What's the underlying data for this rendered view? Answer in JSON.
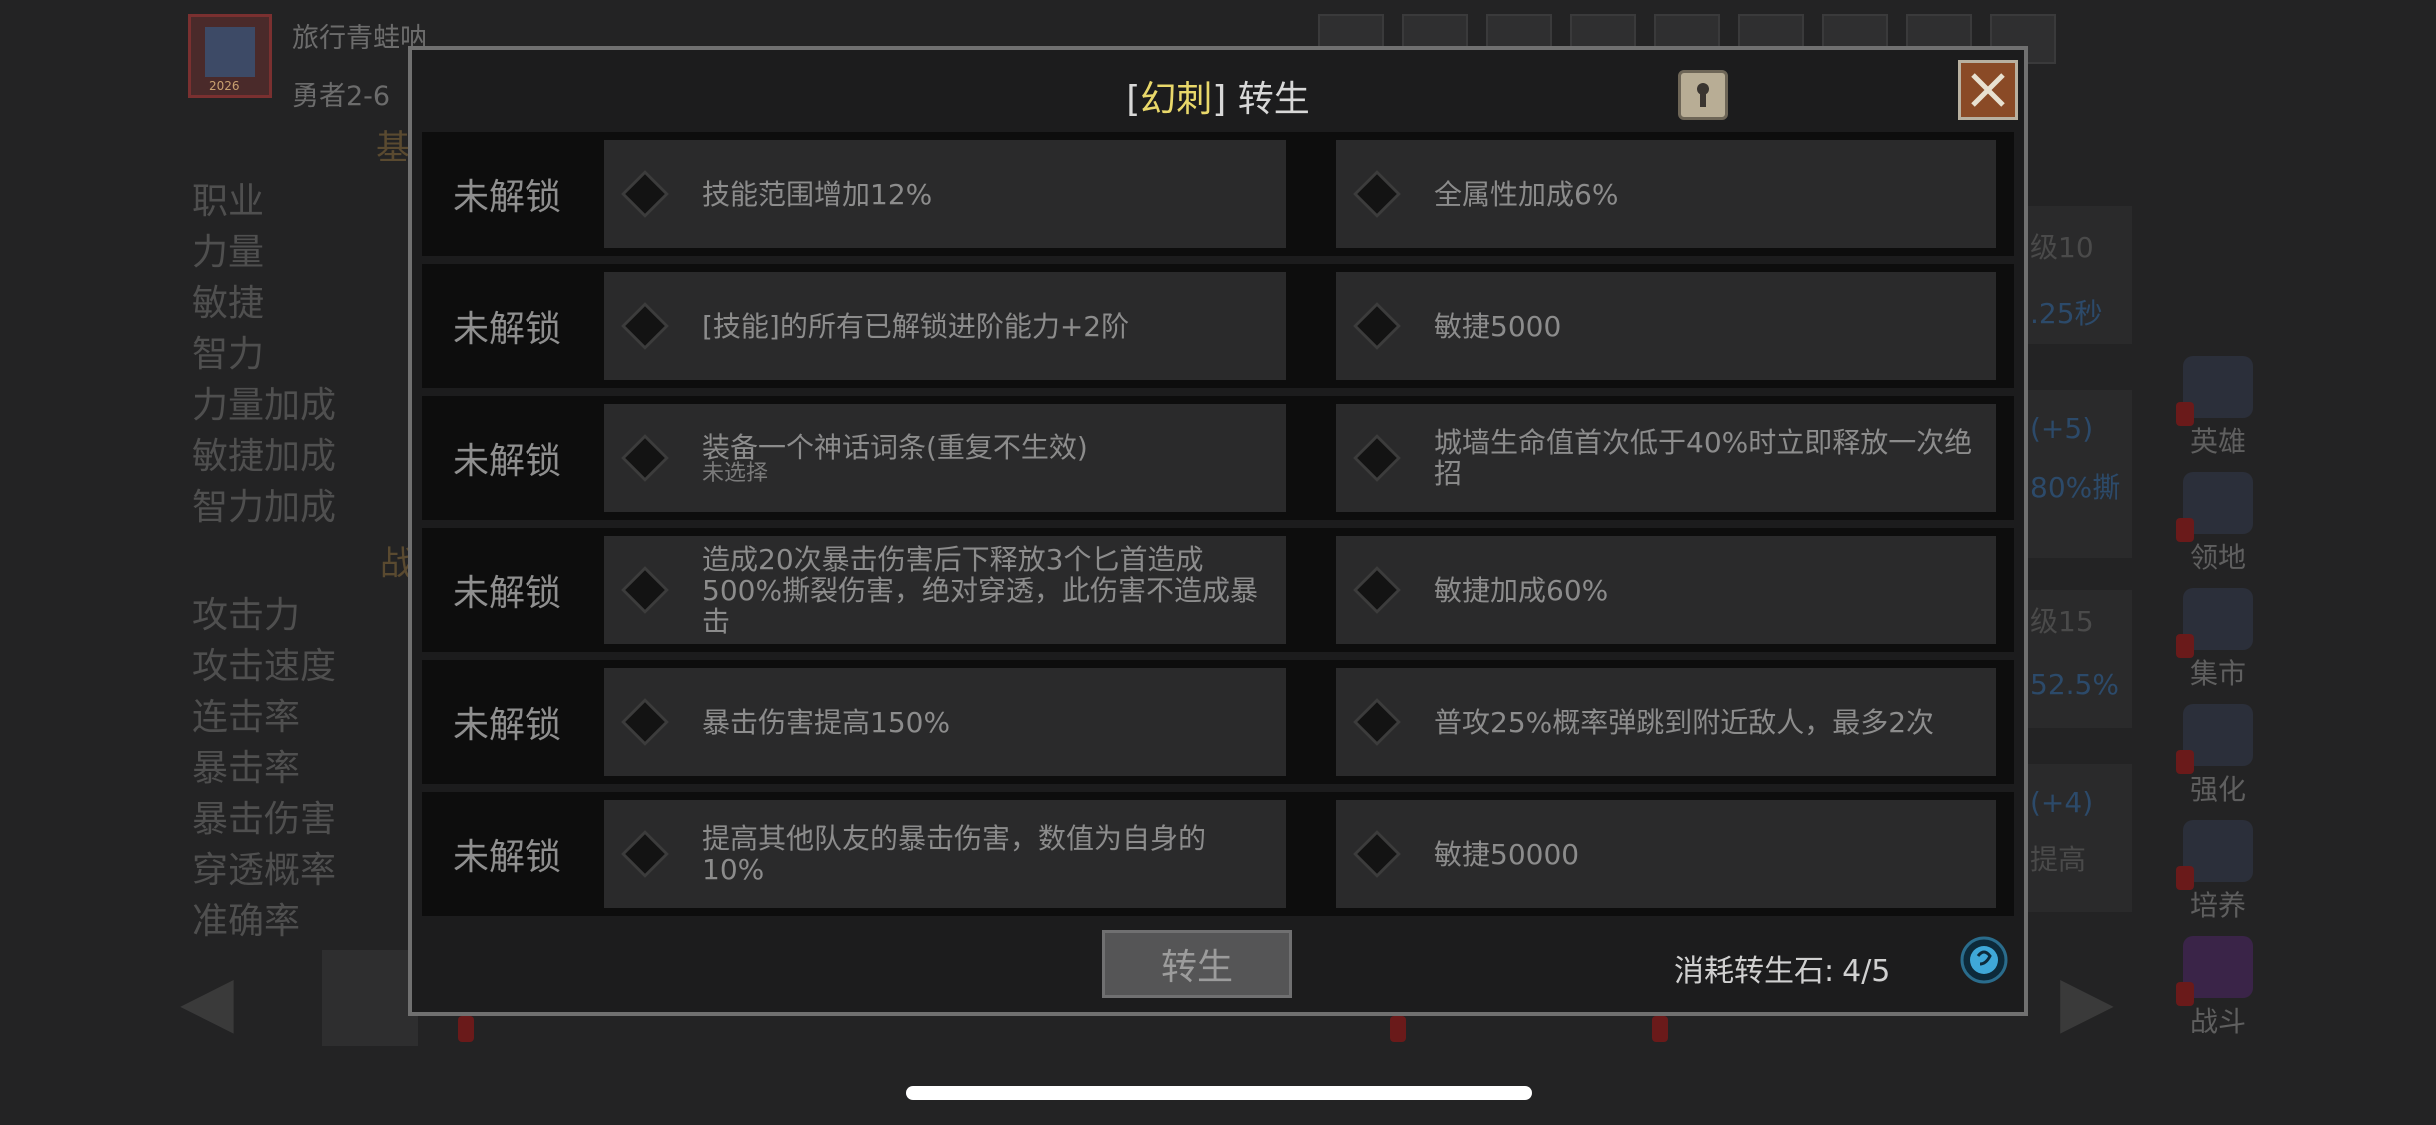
{
  "background": {
    "player_name": "旅行青蛙呐",
    "player_level": "勇者2-6",
    "portrait_year": "2026",
    "section_base": "基",
    "section_combat": "战",
    "stats_base": [
      "职业",
      "力量",
      "敏捷",
      "智力",
      "力量加成",
      "敏捷加成",
      "智力加成"
    ],
    "stats_combat": [
      "攻击力",
      "攻击速度",
      "连击率",
      "暴击率",
      "暴击伤害",
      "穿透概率",
      "准确率"
    ],
    "right_texts": [
      "级10",
      ".25秒",
      "(+5)",
      "80%撕",
      "级15",
      "52.5%",
      "(+4)",
      "提高"
    ],
    "side_menu": [
      {
        "label": "英雄"
      },
      {
        "label": "领地"
      },
      {
        "label": "集市"
      },
      {
        "label": "强化"
      },
      {
        "label": "培养"
      },
      {
        "label": "战斗"
      }
    ]
  },
  "modal": {
    "title_open": "[",
    "title_tag": "幻刺",
    "title_close": "]",
    "title": "转生",
    "rows": [
      {
        "status": "未解锁",
        "left": "技能范围增加12%",
        "right": "全属性加成6%"
      },
      {
        "status": "未解锁",
        "left": "[技能]的所有已解锁进阶能力+2阶",
        "right": "敏捷5000"
      },
      {
        "status": "未解锁",
        "left": "装备一个神话词条(重复不生效)",
        "left_sub": "未选择",
        "right": "城墙生命值首次低于40%时立即释放一次绝招"
      },
      {
        "status": "未解锁",
        "left": "造成20次暴击伤害后下释放3个匕首造成500%撕裂伤害，绝对穿透，此伤害不造成暴击",
        "right": "敏捷加成60%"
      },
      {
        "status": "未解锁",
        "left": "暴击伤害提高150%",
        "right": "普攻25%概率弹跳到附近敌人，最多2次"
      },
      {
        "status": "未解锁",
        "left": "提高其他队友的暴击伤害，数值为自身的10%",
        "right": "敏捷50000"
      }
    ],
    "button_label": "转生",
    "cost_label": "消耗转生石:",
    "cost_value": "4/5"
  },
  "colors": {
    "accent_tag": "#e9d86a",
    "close_button": "#8a4a26",
    "stone": "#3fa8d8"
  }
}
